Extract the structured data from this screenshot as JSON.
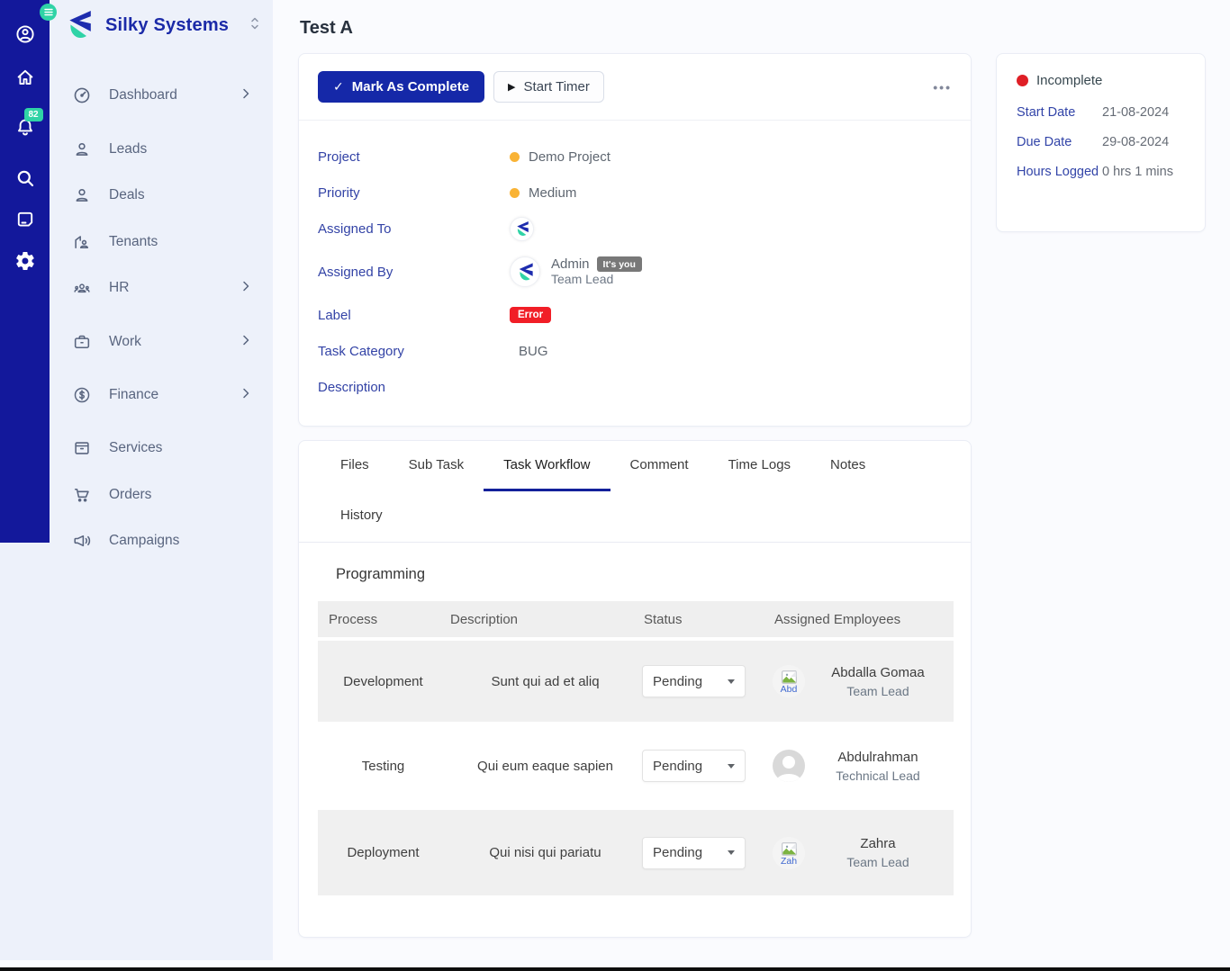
{
  "colors": {
    "brand_blue": "#13189b",
    "button_blue": "#1528a8",
    "accent_green": "#2fd3a6",
    "sidebar_bg": "#edf1fa",
    "label_blue": "#3343a6",
    "priority_yellow": "#f9b335",
    "status_red": "#df1f26",
    "error_red": "#f11e27",
    "tab_underline": "#13219b"
  },
  "rail": {
    "notification_count": "82",
    "icons": [
      "account",
      "home",
      "notifications",
      "search",
      "notes",
      "settings"
    ]
  },
  "sidebar": {
    "brand": "Silky Systems",
    "items": [
      {
        "label": "Dashboard",
        "chevron": true
      },
      {
        "label": "Leads",
        "chevron": false
      },
      {
        "label": "Deals",
        "chevron": false
      },
      {
        "label": "Tenants",
        "chevron": false
      },
      {
        "label": "HR",
        "chevron": true
      },
      {
        "label": "Work",
        "chevron": true
      },
      {
        "label": "Finance",
        "chevron": true
      },
      {
        "label": "Services",
        "chevron": false
      },
      {
        "label": "Orders",
        "chevron": false
      },
      {
        "label": "Campaigns",
        "chevron": false
      }
    ]
  },
  "page": {
    "title": "Test A"
  },
  "task": {
    "actions": {
      "complete": "Mark As Complete",
      "timer": "Start Timer",
      "more": "•••"
    },
    "fields": {
      "project": {
        "label": "Project",
        "value": "Demo Project"
      },
      "priority": {
        "label": "Priority",
        "value": "Medium"
      },
      "assigned_to": {
        "label": "Assigned To"
      },
      "assigned_by": {
        "label": "Assigned By",
        "name": "Admin",
        "badge": "It's you",
        "role": "Team Lead"
      },
      "task_label": {
        "label": "Label",
        "tag": "Error"
      },
      "category": {
        "label": "Task Category",
        "value": "BUG"
      },
      "description": {
        "label": "Description",
        "value": ""
      }
    }
  },
  "status_card": {
    "status": "Incomplete",
    "rows": [
      {
        "label": "Start Date",
        "value": "21-08-2024"
      },
      {
        "label": "Due Date",
        "value": "29-08-2024"
      },
      {
        "label": "Hours Logged",
        "value": "0 hrs 1 mins"
      }
    ]
  },
  "tabs": {
    "active": "Task Workflow",
    "items": [
      {
        "label": "Files"
      },
      {
        "label": "Sub Task"
      },
      {
        "label": "Task Workflow"
      },
      {
        "label": "Comment"
      },
      {
        "label": "Time Logs"
      },
      {
        "label": "Notes"
      },
      {
        "label": "History"
      }
    ]
  },
  "workflow": {
    "title": "Programming",
    "columns": [
      "Process",
      "Description",
      "Status",
      "Assigned Employees"
    ],
    "rows": [
      {
        "process": "Development",
        "description": "Sunt qui ad et aliq",
        "status": "Pending",
        "employee": {
          "name": "Abdalla Gomaa",
          "role": "Team Lead",
          "avatar": "broken-image",
          "alt": "Abd"
        }
      },
      {
        "process": "Testing",
        "description": "Qui eum eaque sapien",
        "status": "Pending",
        "employee": {
          "name": "Abdulrahman",
          "role": "Technical Lead",
          "avatar": "placeholder",
          "alt": ""
        }
      },
      {
        "process": "Deployment",
        "description": "Qui nisi qui pariatu",
        "status": "Pending",
        "employee": {
          "name": "Zahra",
          "role": "Team Lead",
          "avatar": "broken-image",
          "alt": "Zah"
        }
      }
    ]
  }
}
